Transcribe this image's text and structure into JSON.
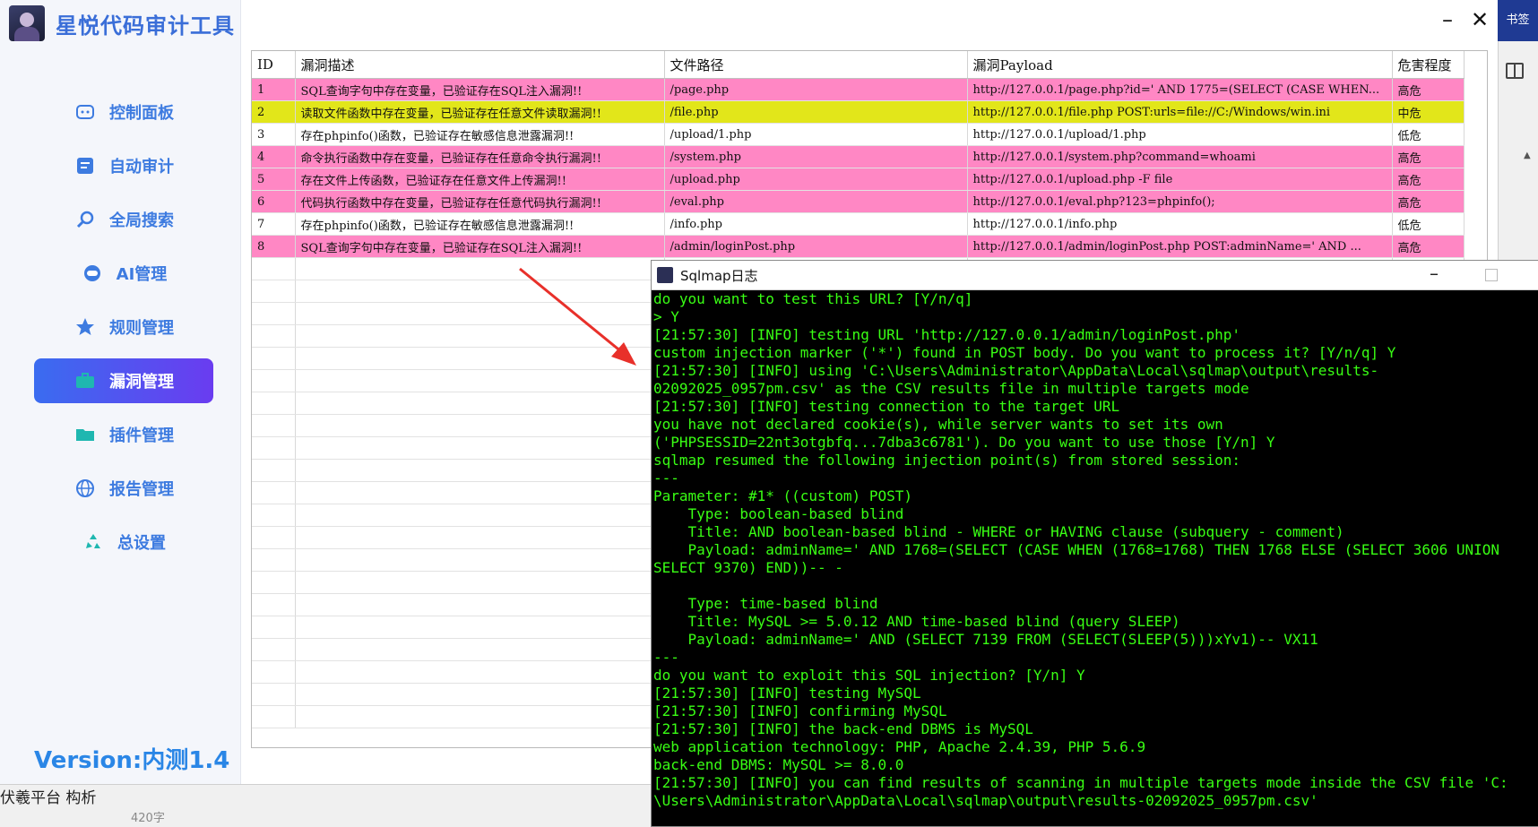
{
  "app": {
    "title": "星悦代码审计工具",
    "version": "Version:内测1.4",
    "minimize": "–",
    "close": "✕"
  },
  "sidebar": {
    "items": [
      {
        "label": "控制面板",
        "icon": "dashboard-icon",
        "active": false
      },
      {
        "label": "自动审计",
        "icon": "audit-icon",
        "active": false
      },
      {
        "label": "全局搜索",
        "icon": "search-icon",
        "active": false
      },
      {
        "label": "AI管理",
        "icon": "robot-icon",
        "active": false
      },
      {
        "label": "规则管理",
        "icon": "star-icon",
        "active": false
      },
      {
        "label": "漏洞管理",
        "icon": "briefcase-icon",
        "active": true
      },
      {
        "label": "插件管理",
        "icon": "folder-icon",
        "active": false
      },
      {
        "label": "报告管理",
        "icon": "globe-icon",
        "active": false
      },
      {
        "label": "总设置",
        "icon": "recycle-icon",
        "active": false
      }
    ]
  },
  "right_edge": {
    "tab_label": "书签"
  },
  "table": {
    "headers": [
      "ID",
      "漏洞描述",
      "文件路径",
      "漏洞Payload",
      "危害程度"
    ],
    "rows": [
      {
        "id": "1",
        "desc": "SQL查询字句中存在变量，已验证存在SQL注入漏洞!!",
        "path": "/page.php",
        "payload": "http://127.0.0.1/page.php?id=' AND 1775=(SELECT (CASE WHEN...",
        "level": "高危",
        "severity": "high"
      },
      {
        "id": "2",
        "desc": "读取文件函数中存在变量，已验证存在任意文件读取漏洞!!",
        "path": "/file.php",
        "payload": "http://127.0.0.1/file.php POST:urls=file://C:/Windows/win.ini",
        "level": "中危",
        "severity": "mid"
      },
      {
        "id": "3",
        "desc": "存在phpinfo()函数，已验证存在敏感信息泄露漏洞!!",
        "path": "/upload/1.php",
        "payload": "http://127.0.0.1/upload/1.php",
        "level": "低危",
        "severity": "low"
      },
      {
        "id": "4",
        "desc": "命令执行函数中存在变量，已验证存在任意命令执行漏洞!!",
        "path": "/system.php",
        "payload": "http://127.0.0.1/system.php?command=whoami",
        "level": "高危",
        "severity": "high"
      },
      {
        "id": "5",
        "desc": "存在文件上传函数，已验证存在任意文件上传漏洞!!",
        "path": "/upload.php",
        "payload": "http://127.0.0.1/upload.php -F file",
        "level": "高危",
        "severity": "high"
      },
      {
        "id": "6",
        "desc": "代码执行函数中存在变量，已验证存在任意代码执行漏洞!!",
        "path": "/eval.php",
        "payload": "http://127.0.0.1/eval.php?123=phpinfo();",
        "level": "高危",
        "severity": "high"
      },
      {
        "id": "7",
        "desc": "存在phpinfo()函数，已验证存在敏感信息泄露漏洞!!",
        "path": "/info.php",
        "payload": "http://127.0.0.1/info.php",
        "level": "低危",
        "severity": "low"
      },
      {
        "id": "8",
        "desc": "SQL查询字句中存在变量，已验证存在SQL注入漏洞!!",
        "path": "/admin/loginPost.php",
        "payload": "http://127.0.0.1/admin/loginPost.php POST:adminName=' AND ...",
        "level": "高危",
        "severity": "high"
      }
    ]
  },
  "colors": {
    "high": "#ff87c4",
    "mid": "#e2e61a",
    "low": "#ffffff",
    "accent": "#3a6cf0",
    "terminal_text": "#39ff14"
  },
  "log_window": {
    "title": "Sqlmap日志",
    "lines": [
      "do you want to test this URL? [Y/n/q]",
      "> Y",
      "[21:57:30] [INFO] testing URL 'http://127.0.0.1/admin/loginPost.php'",
      "custom injection marker ('*') found in POST body. Do you want to process it? [Y/n/q] Y",
      "[21:57:30] [INFO] using 'C:\\Users\\Administrator\\AppData\\Local\\sqlmap\\output\\results-",
      "02092025_0957pm.csv' as the CSV results file in multiple targets mode",
      "[21:57:30] [INFO] testing connection to the target URL",
      "you have not declared cookie(s), while server wants to set its own",
      "('PHPSESSID=22nt3otgbfq...7dba3c6781'). Do you want to use those [Y/n] Y",
      "sqlmap resumed the following injection point(s) from stored session:",
      "---",
      "Parameter: #1* ((custom) POST)",
      "    Type: boolean-based blind",
      "    Title: AND boolean-based blind - WHERE or HAVING clause (subquery - comment)",
      "    Payload: adminName=' AND 1768=(SELECT (CASE WHEN (1768=1768) THEN 1768 ELSE (SELECT 3606 UNION",
      "SELECT 9370) END))-- -",
      "",
      "    Type: time-based blind",
      "    Title: MySQL >= 5.0.12 AND time-based blind (query SLEEP)",
      "    Payload: adminName=' AND (SELECT 7139 FROM (SELECT(SLEEP(5)))xYv1)-- VX11",
      "---",
      "do you want to exploit this SQL injection? [Y/n] Y",
      "[21:57:30] [INFO] testing MySQL",
      "[21:57:30] [INFO] confirming MySQL",
      "[21:57:30] [INFO] the back-end DBMS is MySQL",
      "web application technology: PHP, Apache 2.4.39, PHP 5.6.9",
      "back-end DBMS: MySQL >= 8.0.0",
      "[21:57:30] [INFO] you can find results of scanning in multiple targets mode inside the CSV file 'C:",
      "\\Users\\Administrator\\AppData\\Local\\sqlmap\\output\\results-02092025_0957pm.csv'"
    ]
  },
  "bottom": {
    "text": "伏羲平台 构析",
    "count": "420字"
  }
}
